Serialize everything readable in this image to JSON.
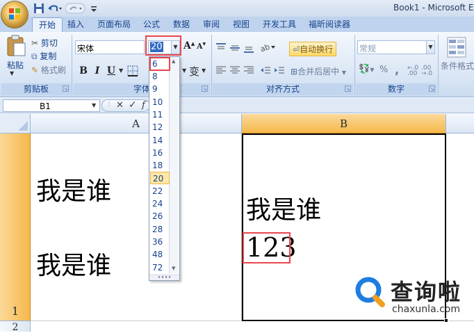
{
  "window": {
    "title": "Book1 - Microsoft Ex"
  },
  "tabs": [
    "开始",
    "插入",
    "页面布局",
    "公式",
    "数据",
    "审阅",
    "视图",
    "开发工具",
    "福昕阅读器"
  ],
  "clipboard": {
    "paste": "粘贴",
    "cut": "剪切",
    "copy": "复制",
    "format_painter": "格式刷",
    "group_label": "剪贴板"
  },
  "font": {
    "name": "宋体",
    "size": "20",
    "grow": "A",
    "shrink": "A",
    "bold": "B",
    "italic": "I",
    "underline": "U",
    "group_label": "字体"
  },
  "alignment": {
    "wrap_text": "自动换行",
    "merge_center": "合并后居中",
    "group_label": "对齐方式"
  },
  "number": {
    "format": "常规",
    "percent": "%",
    "comma": ",",
    "group_label": "数字"
  },
  "styles": {
    "conditional_format": "条件格式"
  },
  "formula_bar": {
    "name_box": "B1",
    "cancel": "✕",
    "enter": "✓",
    "fx": "f"
  },
  "font_size_list": [
    "6",
    "8",
    "9",
    "10",
    "11",
    "12",
    "14",
    "16",
    "18",
    "20",
    "22",
    "24",
    "26",
    "28",
    "36",
    "48",
    "72"
  ],
  "font_size_selected": "20",
  "sheet": {
    "columns": [
      "A",
      "B"
    ],
    "rows": [
      "1",
      "2"
    ],
    "cells": {
      "A1": [
        "我是谁",
        "我是谁"
      ],
      "B1": [
        "我是谁",
        "123"
      ]
    }
  },
  "watermark": {
    "cn": "查询啦",
    "en": "chaxunla.com"
  },
  "colors": {
    "accent_red": "#e8464c",
    "selection_orange": "#f5b84a",
    "ribbon_blue": "#dde8f6",
    "highlight_gold": "#fde7a8"
  }
}
